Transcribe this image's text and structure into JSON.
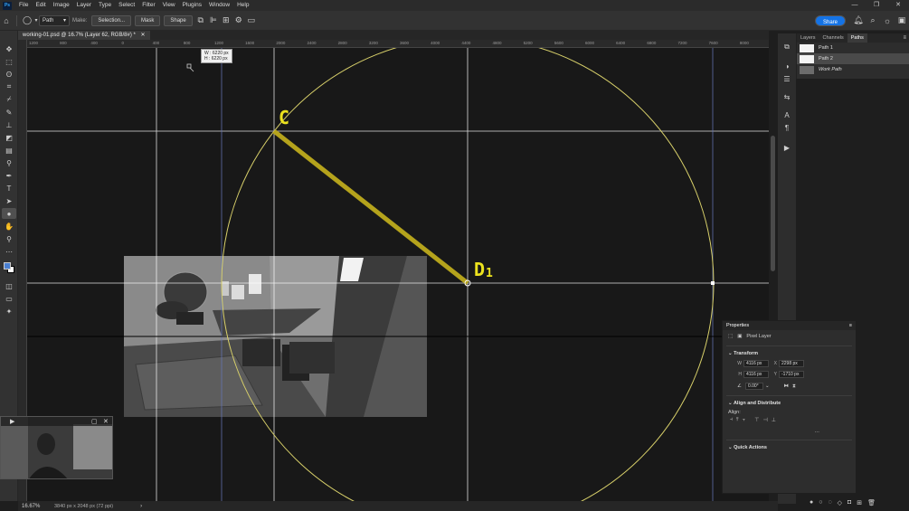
{
  "app": {
    "logo": "Ps",
    "menu": [
      "File",
      "Edit",
      "Image",
      "Layer",
      "Type",
      "Select",
      "Filter",
      "View",
      "Plugins",
      "Window",
      "Help"
    ],
    "window_controls": [
      "—",
      "❐",
      "✕"
    ]
  },
  "options_bar": {
    "mode_select": "Path",
    "make_label": "Make:",
    "selection_btn": "Selection...",
    "mask_btn": "Mask",
    "shape_btn": "Shape",
    "share_btn": "Share"
  },
  "document": {
    "tab_title": "working-01.psd @ 16.7% (Layer 62, RGB/8#) *",
    "tab_close": "✕"
  },
  "ruler": {
    "h_ticks": [
      "1200",
      "800",
      "400",
      "0",
      "400",
      "800",
      "1200",
      "1600",
      "2000",
      "2400",
      "2800",
      "3200",
      "3600",
      "4000",
      "4400",
      "4800",
      "5200",
      "5600",
      "6000",
      "6400",
      "6800",
      "7200",
      "7600",
      "8000"
    ]
  },
  "canvas": {
    "label_c": "C",
    "label_d": "D",
    "label_d_sub": "1",
    "measure_w": "W :  6220 px",
    "measure_h": "H :  6220 px",
    "accent_yellow": "#c9b80f",
    "circle_color": "#e0d86a"
  },
  "panels": {
    "tabs": [
      "Layers",
      "Channels",
      "Paths"
    ],
    "active_tab": "Paths",
    "paths": [
      {
        "name": "Path 1",
        "selected": false
      },
      {
        "name": "Path 2",
        "selected": true
      },
      {
        "name": "Work Path",
        "selected": false
      }
    ]
  },
  "properties": {
    "title": "Properties",
    "layer_type": "Pixel Layer",
    "transform_title": "Transform",
    "w_label": "W",
    "w_value": "4116 px",
    "h_label": "H",
    "h_value": "4116 px",
    "x_label": "X",
    "x_value": "2298 px",
    "y_label": "Y",
    "y_value": "-1710 px",
    "angle_value": "0.00°",
    "align_title": "Align and Distribute",
    "align_label": "Align:",
    "quick_actions_title": "Quick Actions"
  },
  "status": {
    "zoom": "16.67%",
    "doc_size": "3840 px x 2048 px (72 ppi)"
  }
}
